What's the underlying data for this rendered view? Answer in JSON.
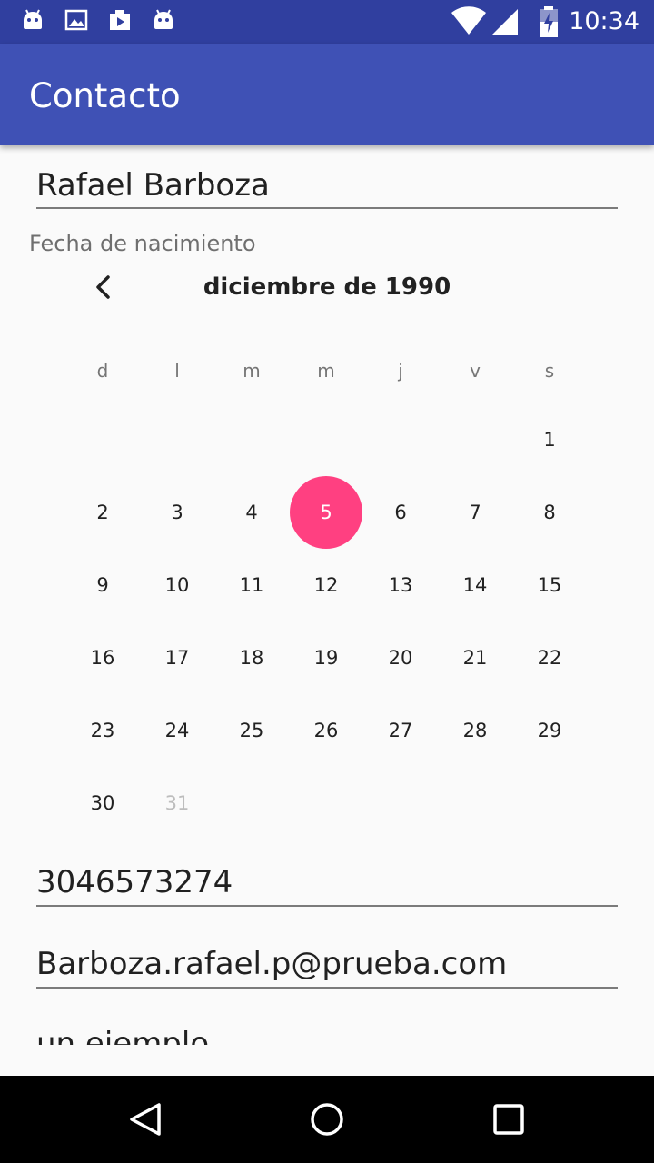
{
  "status_bar": {
    "time": "10:34",
    "left_icons": [
      "android-icon",
      "image-icon",
      "play-store-icon",
      "android-icon"
    ],
    "right_icons": [
      "wifi-icon",
      "signal-icon",
      "battery-charging-icon"
    ],
    "color": "#303f9f"
  },
  "app_bar": {
    "title": "Contacto",
    "color": "#3f51b5"
  },
  "form": {
    "name_value": "Rafael Barboza",
    "birthdate_label": "Fecha de nacimiento",
    "phone_value": "3046573274",
    "email_value": "Barboza.rafael.p@prueba.com",
    "description_value": "un ejemplo"
  },
  "calendar": {
    "month_label": "diciembre de 1990",
    "weekday_headers": [
      "d",
      "l",
      "m",
      "m",
      "j",
      "v",
      "s"
    ],
    "selected_day": 5,
    "disabled_days": [
      31
    ],
    "first_weekday_index": 6,
    "days_in_month": 31,
    "accent_color": "#ff4081"
  },
  "nav_bar": {
    "icons": [
      "back-icon",
      "home-icon",
      "recents-icon"
    ]
  }
}
